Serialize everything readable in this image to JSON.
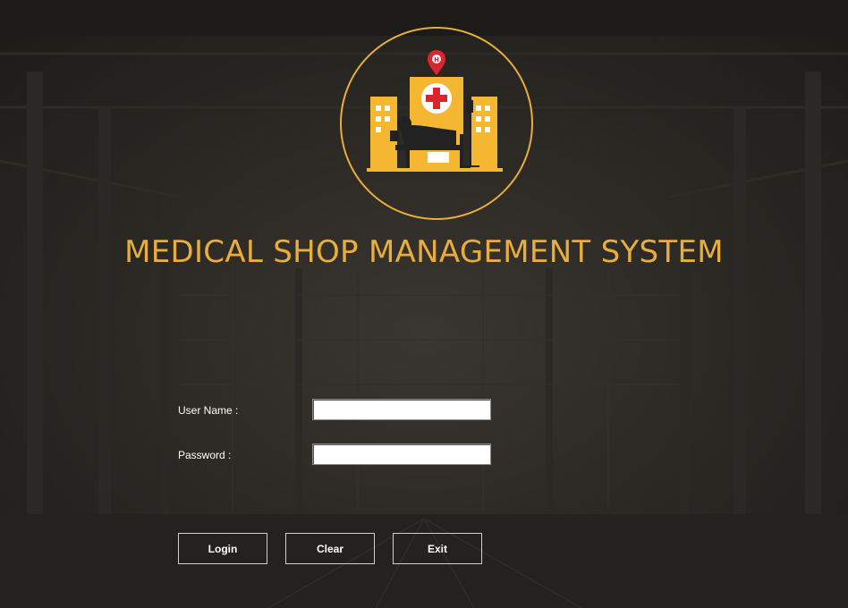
{
  "app": {
    "title": "MEDICAL SHOP MANAGEMENT SYSTEM"
  },
  "logo": {
    "icon": "hospital-icon",
    "pin_letter": "H",
    "accent": "#e9ad3e",
    "building_color": "#f5b731",
    "cross_color": "#d8262c"
  },
  "form": {
    "username_label": "User Name :",
    "username_value": "",
    "password_label": "Password  :",
    "password_value": ""
  },
  "buttons": {
    "login": "Login",
    "clear": "Clear",
    "exit": "Exit"
  },
  "colors": {
    "background": "#262420",
    "title": "#e9ad3e",
    "text": "#ffffff"
  }
}
